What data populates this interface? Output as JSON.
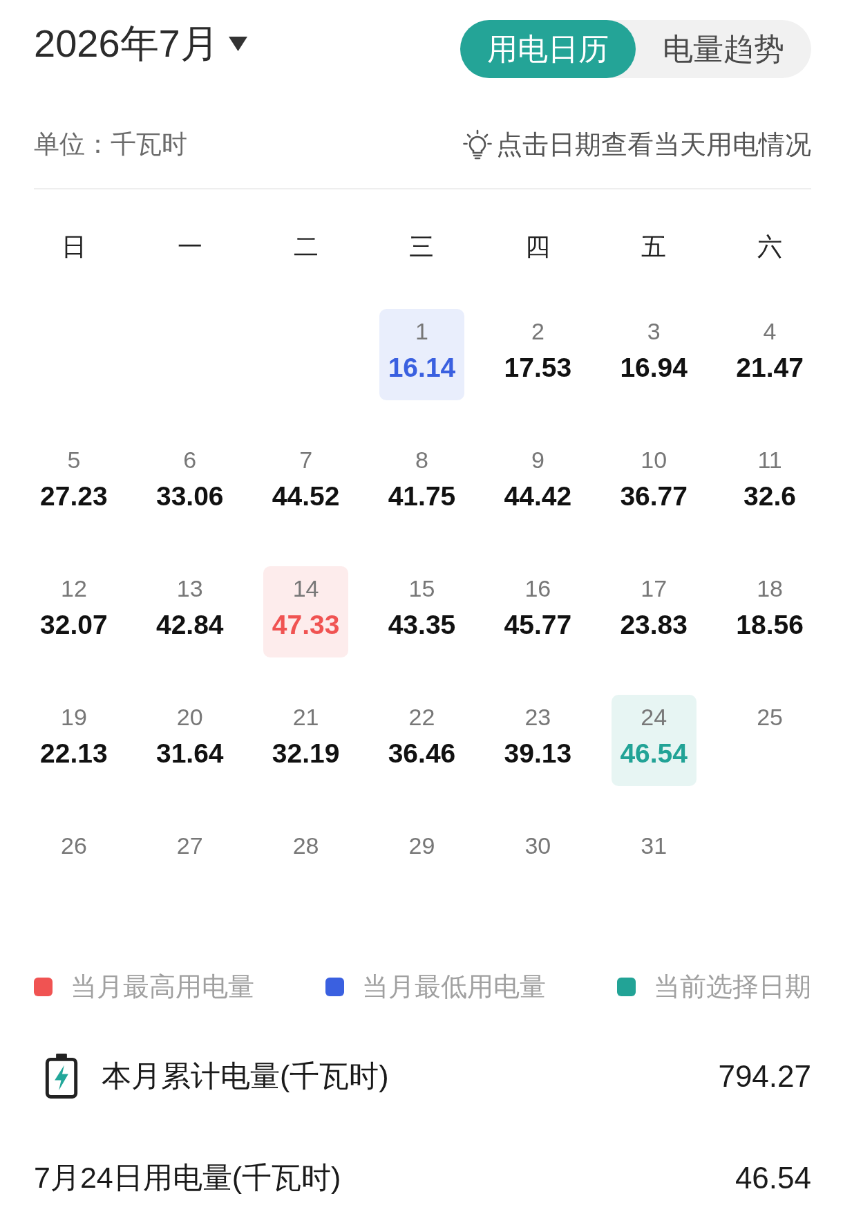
{
  "header": {
    "month_picker": {
      "label": "2026年7月"
    },
    "view_tabs": [
      {
        "label": "用电日历",
        "selected": true
      },
      {
        "label": "电量趋势",
        "selected": false
      }
    ]
  },
  "info_bar": {
    "unit": "单位：千瓦时",
    "hint": "点击日期查看当天用电情况"
  },
  "calendar": {
    "weekdays": [
      "日",
      "一",
      "二",
      "三",
      "四",
      "五",
      "六"
    ],
    "weeks": [
      [
        {
          "kind": "blank"
        },
        {
          "kind": "blank"
        },
        {
          "kind": "blank"
        },
        {
          "kind": "day",
          "day": "1",
          "usage": "16.14",
          "selected": false,
          "highest": false,
          "lowest": true
        },
        {
          "kind": "day",
          "day": "2",
          "usage": "17.53",
          "selected": false,
          "highest": false,
          "lowest": false
        },
        {
          "kind": "day",
          "day": "3",
          "usage": "16.94",
          "selected": false,
          "highest": false,
          "lowest": false
        },
        {
          "kind": "day",
          "day": "4",
          "usage": "21.47",
          "selected": false,
          "highest": false,
          "lowest": false
        }
      ],
      [
        {
          "kind": "day",
          "day": "5",
          "usage": "27.23",
          "selected": false,
          "highest": false,
          "lowest": false
        },
        {
          "kind": "day",
          "day": "6",
          "usage": "33.06",
          "selected": false,
          "highest": false,
          "lowest": false
        },
        {
          "kind": "day",
          "day": "7",
          "usage": "44.52",
          "selected": false,
          "highest": false,
          "lowest": false
        },
        {
          "kind": "day",
          "day": "8",
          "usage": "41.75",
          "selected": false,
          "highest": false,
          "lowest": false
        },
        {
          "kind": "day",
          "day": "9",
          "usage": "44.42",
          "selected": false,
          "highest": false,
          "lowest": false
        },
        {
          "kind": "day",
          "day": "10",
          "usage": "36.77",
          "selected": false,
          "highest": false,
          "lowest": false
        },
        {
          "kind": "day",
          "day": "11",
          "usage": "32.6",
          "selected": false,
          "highest": false,
          "lowest": false
        }
      ],
      [
        {
          "kind": "day",
          "day": "12",
          "usage": "32.07",
          "selected": false,
          "highest": false,
          "lowest": false
        },
        {
          "kind": "day",
          "day": "13",
          "usage": "42.84",
          "selected": false,
          "highest": false,
          "lowest": false
        },
        {
          "kind": "day",
          "day": "14",
          "usage": "47.33",
          "selected": false,
          "highest": true,
          "lowest": false
        },
        {
          "kind": "day",
          "day": "15",
          "usage": "43.35",
          "selected": false,
          "highest": false,
          "lowest": false
        },
        {
          "kind": "day",
          "day": "16",
          "usage": "45.77",
          "selected": false,
          "highest": false,
          "lowest": false
        },
        {
          "kind": "day",
          "day": "17",
          "usage": "23.83",
          "selected": false,
          "highest": false,
          "lowest": false
        },
        {
          "kind": "day",
          "day": "18",
          "usage": "18.56",
          "selected": false,
          "highest": false,
          "lowest": false
        }
      ],
      [
        {
          "kind": "day",
          "day": "19",
          "usage": "22.13",
          "selected": false,
          "highest": false,
          "lowest": false
        },
        {
          "kind": "day",
          "day": "20",
          "usage": "31.64",
          "selected": false,
          "highest": false,
          "lowest": false
        },
        {
          "kind": "day",
          "day": "21",
          "usage": "32.19",
          "selected": false,
          "highest": false,
          "lowest": false
        },
        {
          "kind": "day",
          "day": "22",
          "usage": "36.46",
          "selected": false,
          "highest": false,
          "lowest": false
        },
        {
          "kind": "day",
          "day": "23",
          "usage": "39.13",
          "selected": false,
          "highest": false,
          "lowest": false
        },
        {
          "kind": "day",
          "day": "24",
          "usage": "46.54",
          "selected": true,
          "highest": false,
          "lowest": false
        },
        {
          "kind": "day",
          "day": "25",
          "selected": false,
          "highest": false,
          "lowest": false
        }
      ],
      [
        {
          "kind": "day",
          "day": "26",
          "selected": false,
          "highest": false,
          "lowest": false
        },
        {
          "kind": "day",
          "day": "27",
          "selected": false,
          "highest": false,
          "lowest": false
        },
        {
          "kind": "day",
          "day": "28",
          "selected": false,
          "highest": false,
          "lowest": false
        },
        {
          "kind": "day",
          "day": "29",
          "selected": false,
          "highest": false,
          "lowest": false
        },
        {
          "kind": "day",
          "day": "30",
          "selected": false,
          "highest": false,
          "lowest": false
        },
        {
          "kind": "day",
          "day": "31",
          "selected": false,
          "highest": false,
          "lowest": false
        }
      ]
    ]
  },
  "legend": [
    {
      "label": "当月最高用电量",
      "color": "#f05352"
    },
    {
      "label": "当月最低用电量",
      "color": "#3a60e0"
    },
    {
      "label": "当前选择日期",
      "color": "#22a396"
    }
  ],
  "summary": {
    "month_total": {
      "label": "本月累计电量(千瓦时)",
      "value": "794.27"
    },
    "day_total": {
      "label": "7月24日用电量(千瓦时)",
      "value": "46.54"
    }
  }
}
